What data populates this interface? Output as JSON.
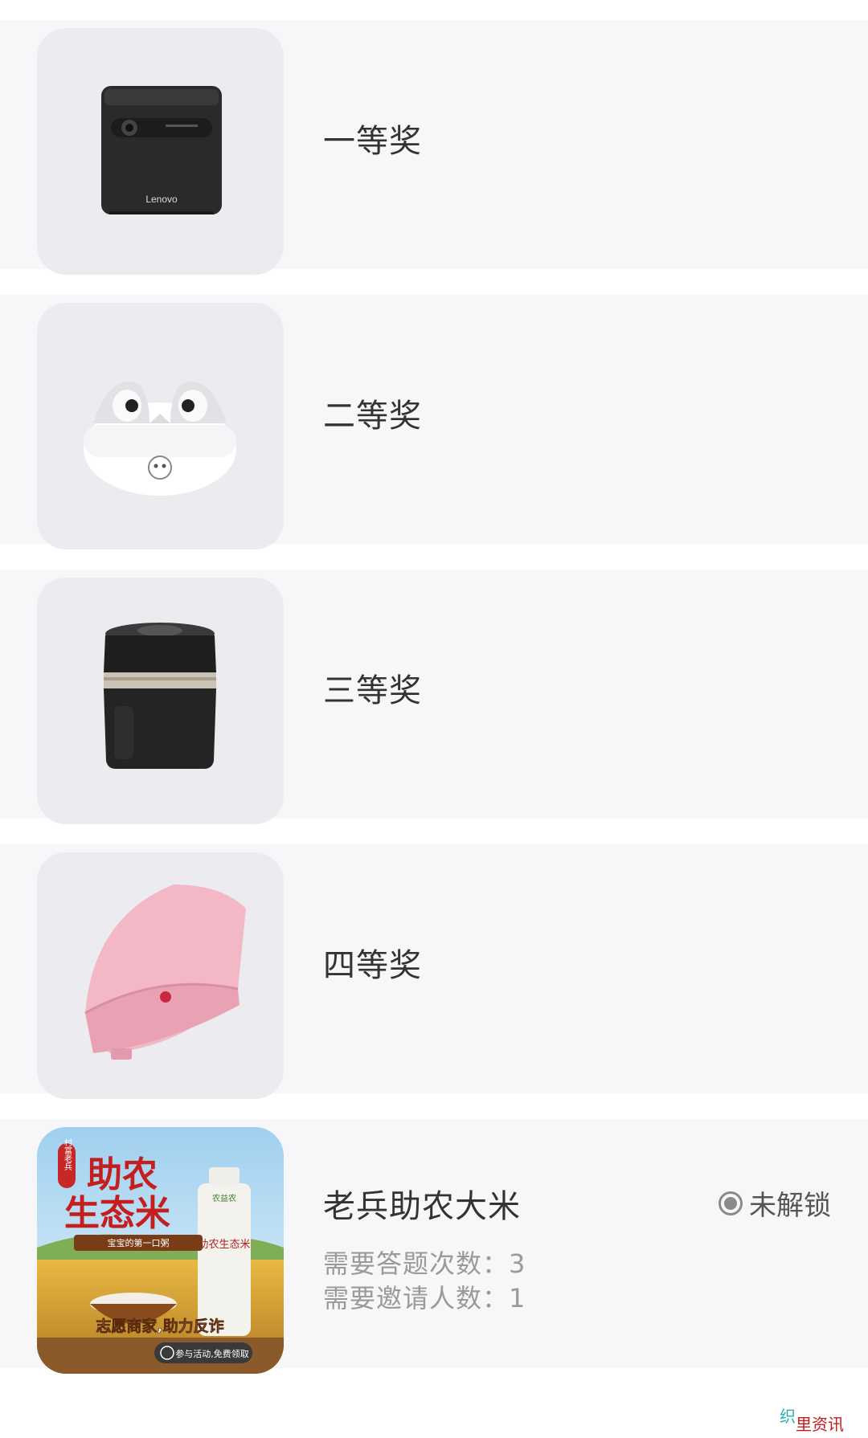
{
  "prizes": [
    {
      "title": "一等奖",
      "image_icon": "projector-image"
    },
    {
      "title": "二等奖",
      "image_icon": "earbuds-image"
    },
    {
      "title": "三等奖",
      "image_icon": "air-fryer-image"
    },
    {
      "title": "四等奖",
      "image_icon": "sandwich-maker-image"
    },
    {
      "title": "老兵助农大米",
      "image_icon": "rice-poster-image",
      "status": "未解锁",
      "answers_label": "需要答题次数：",
      "answers_value": "3",
      "invites_label": "需要邀请人数：",
      "invites_value": "1",
      "poster": {
        "headline_1": "助农",
        "headline_2": "生态米",
        "side_stamp": "村富老兵",
        "ribbon": "宝宝的第一口粥",
        "slogan": "志愿商家,助力反诈",
        "cta": "参与活动,免费领取",
        "bag_brand": "农益农",
        "bag_title": "助农生态米"
      }
    }
  ],
  "watermark": {
    "part1": "织",
    "part2": "里资讯"
  },
  "colors": {
    "row_bg": "#f7f7f9",
    "thumb_bg": "#ececf0",
    "muted_text": "#9a9a9a"
  }
}
